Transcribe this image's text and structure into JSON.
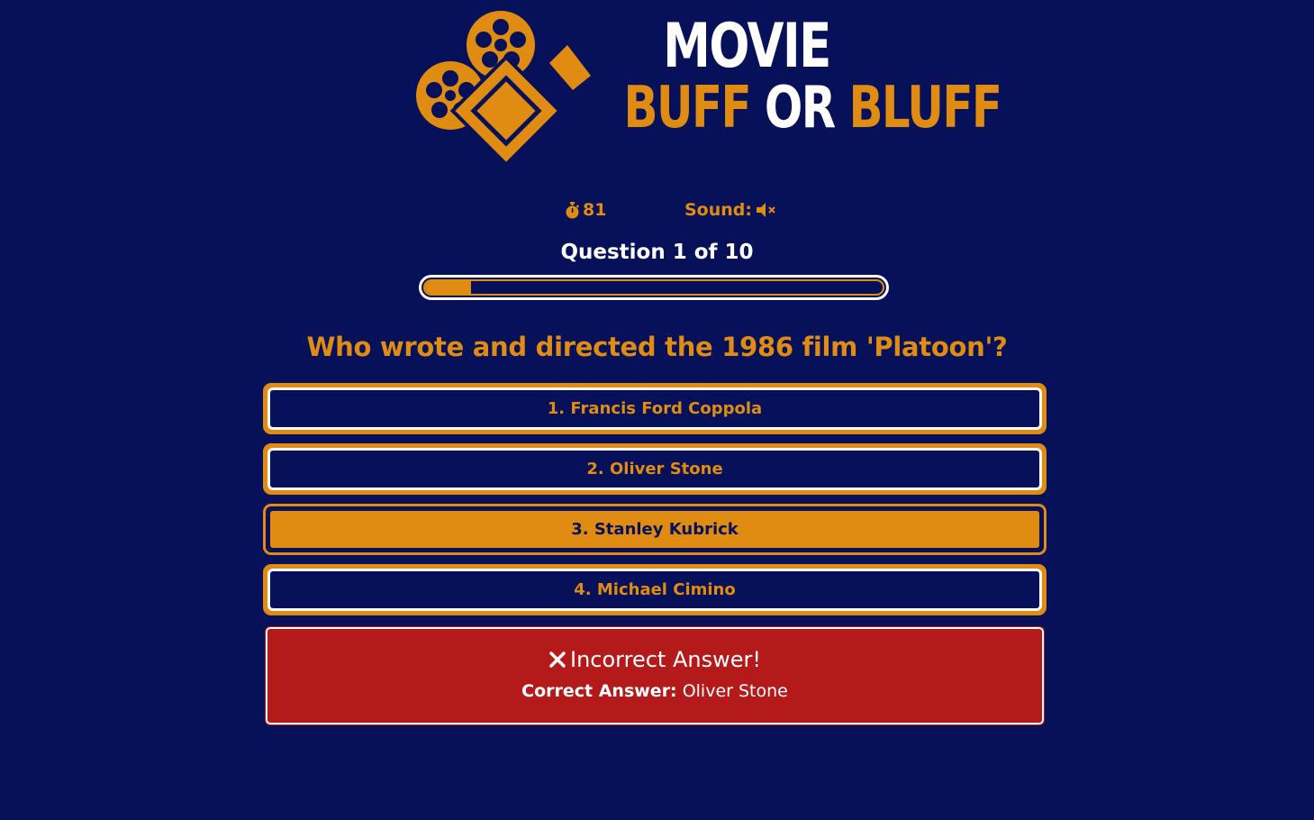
{
  "app": {
    "title_line1": "MOVIE",
    "title_buff": "BUFF",
    "title_or": "OR",
    "title_bluff": "BLUFF",
    "logo_icon": "film-camera-icon"
  },
  "status": {
    "timer_icon": "stopwatch-icon",
    "timer_value": "81",
    "sound_label": "Sound:",
    "sound_icon": "speaker-muted-icon"
  },
  "quiz": {
    "counter": "Question 1 of 10",
    "progress_fraction": 0.1,
    "question": "Who wrote and directed the 1986 film 'Platoon'?",
    "answers": [
      {
        "label": "1. Francis Ford Coppola",
        "selected": false
      },
      {
        "label": "2. Oliver Stone",
        "selected": false
      },
      {
        "label": "3. Stanley Kubrick",
        "selected": true
      },
      {
        "label": "4. Michael Cimino",
        "selected": false
      }
    ]
  },
  "feedback": {
    "icon": "x-mark-icon",
    "title": "Incorrect Answer!",
    "correct_label": "Correct Answer:",
    "correct_value": "Oliver Stone"
  },
  "colors": {
    "background": "#06115a",
    "accent": "#e08c13",
    "error": "#b41a1a",
    "text_light": "#ffffff"
  }
}
